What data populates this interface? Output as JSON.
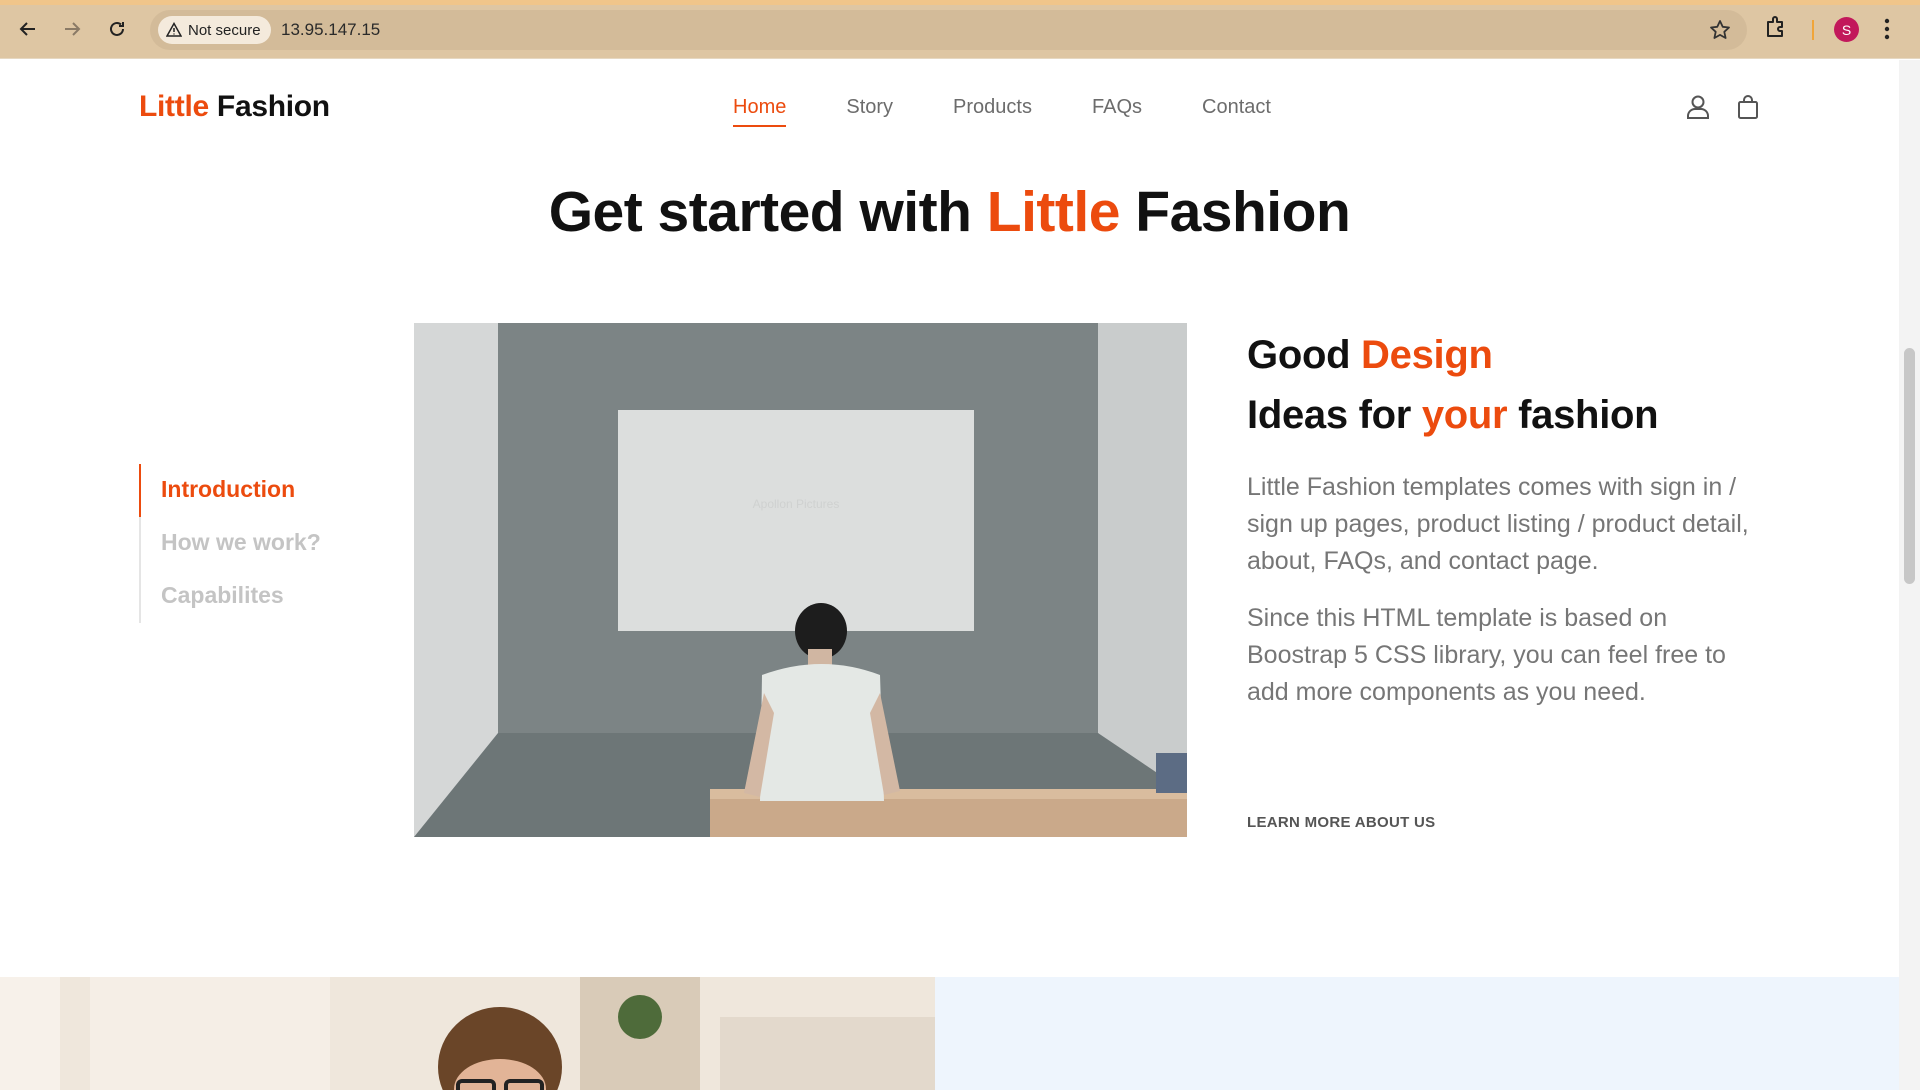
{
  "browser": {
    "security_label": "Not secure",
    "url": "13.95.147.15",
    "profile_initial": "S"
  },
  "site": {
    "brand_accent": "Little",
    "brand_dark": "Fashion",
    "nav": [
      {
        "label": "Home",
        "active": true
      },
      {
        "label": "Story"
      },
      {
        "label": "Products"
      },
      {
        "label": "FAQs"
      },
      {
        "label": "Contact"
      }
    ]
  },
  "hero": {
    "title_part1": "Get started with ",
    "title_accent": "Little",
    "title_part2": " Fashion"
  },
  "tabs": [
    "Introduction",
    "How we work?",
    "Capabilites"
  ],
  "intro": {
    "heading_line1_a": "Good ",
    "heading_line1_accent": "Design",
    "heading_line2_a": "Ideas for ",
    "heading_line2_accent": "your",
    "heading_line2_b": " fashion",
    "para1": "Little Fashion templates comes with sign in / sign up pages, product listing / product detail, about, FAQs, and contact page.",
    "para2": "Since this HTML template is based on Boostrap 5 CSS library, you can feel free to add more components as you need.",
    "learn_more": "LEARN MORE ABOUT US",
    "image_screen_text": "Apollon Pictures"
  },
  "colors": {
    "accent": "#ec4b0e",
    "browser_bar": "#dec6a3"
  }
}
